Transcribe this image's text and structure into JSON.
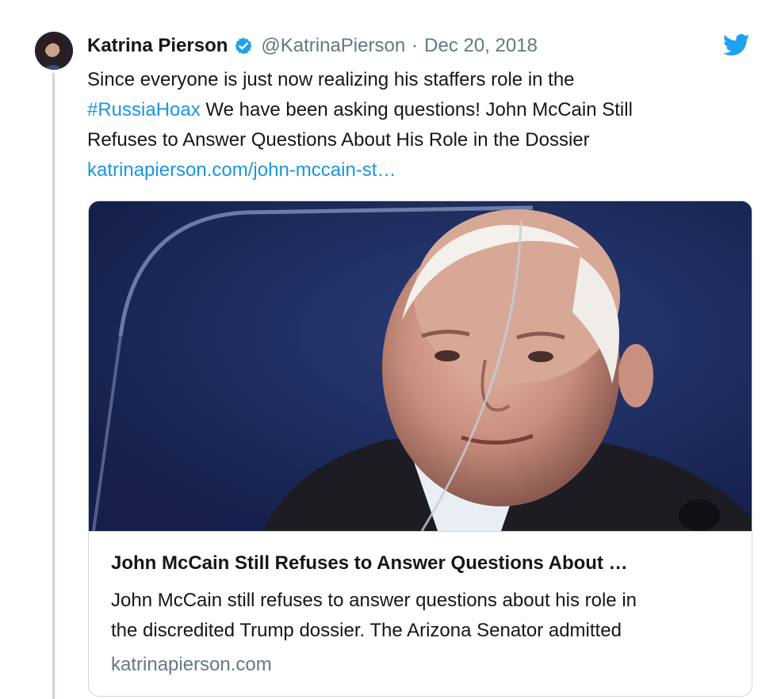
{
  "tweet": {
    "author_name": "Katrina Pierson",
    "author_handle": "@KatrinaPierson",
    "separator": "·",
    "date": "Dec 20, 2018",
    "text_lines": {
      "line1": "Since everyone is just now realizing his staffers role in the",
      "line2_hashtag": "#RussiaHoax",
      "line2_rest": " We have been asking questions! John McCain Still",
      "line3": "Refuses to Answer Questions About His Role in the Dossier",
      "line4_link": "katrinapierson.com/john-mccain-st…"
    }
  },
  "card": {
    "title": "John McCain Still Refuses to Answer Questions About …",
    "description_lines": {
      "line1": "John McCain still refuses to answer questions about his role in",
      "line2": "the discredited Trump dossier. The Arizona Senator admitted"
    },
    "domain": "katrinapierson.com"
  },
  "icons": {
    "verified": "verified-badge-icon",
    "platform": "twitter-bird-icon"
  },
  "colors": {
    "link": "#1b95e0",
    "secondary_text": "#657786",
    "verified_badge": "#1da1f2",
    "twitter_blue": "#1da1f2",
    "border": "#ccd6dd"
  }
}
